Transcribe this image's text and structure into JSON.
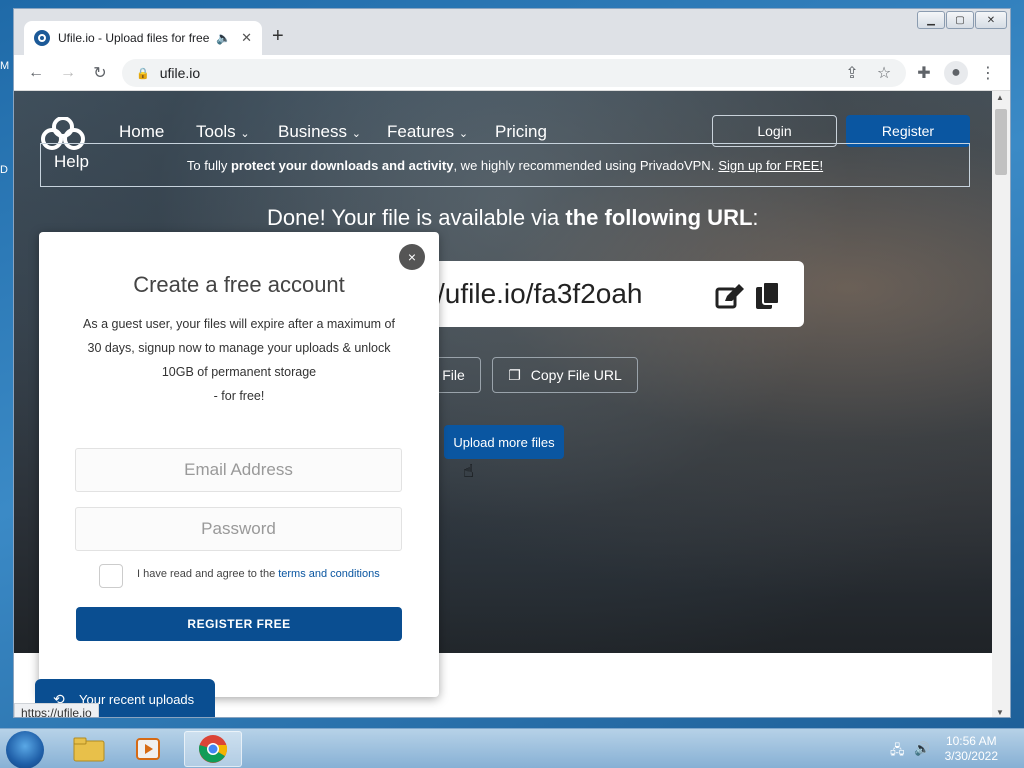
{
  "desktop": {
    "left_letters": [
      "M",
      "D"
    ]
  },
  "browser": {
    "tab_title": "Ufile.io - Upload files for free",
    "tab_audio_icon": "speaker-icon",
    "tab_close": "✕",
    "new_tab": "+",
    "url": "ufile.io",
    "window_controls": [
      "minimize",
      "maximize",
      "close"
    ]
  },
  "site": {
    "nav": [
      "Home",
      "Tools",
      "Business",
      "Features",
      "Pricing"
    ],
    "help": "Help",
    "login": "Login",
    "register": "Register",
    "notice": {
      "prefix": "To fully ",
      "bold": "protect your downloads and activity",
      "middle": ", we highly recommended using PrivadoVPN.",
      "link": "Sign up for FREE!"
    },
    "done": {
      "plain": "Done! Your file is available via ",
      "bold": "the following URL",
      "end": ":"
    },
    "file_url": "/ufile.io/fa3f2oah",
    "file_btn": "File",
    "copy_url_btn": "Copy File URL",
    "upload_more": "Upload more files",
    "recent_uploads": "Your recent uploads",
    "status_url": "https://ufile.io"
  },
  "modal": {
    "close": "×",
    "title": "Create a free account",
    "desc_lines": [
      "As a guest user, your files will expire after a maximum of",
      "30 days, signup now to manage your uploads & unlock",
      "10GB of permanent storage",
      "- for free!"
    ],
    "email_placeholder": "Email Address",
    "password_placeholder": "Password",
    "agree_text": "I have read and agree to the",
    "terms_link": "terms and conditions",
    "register_button": "REGISTER FREE"
  },
  "taskbar": {
    "time": "10:56 AM",
    "date": "3/30/2022",
    "apps": [
      "explorer",
      "media-player",
      "chrome"
    ]
  },
  "colors": {
    "brand_blue": "#0a56a1",
    "dark_blue": "#0a4e91"
  }
}
